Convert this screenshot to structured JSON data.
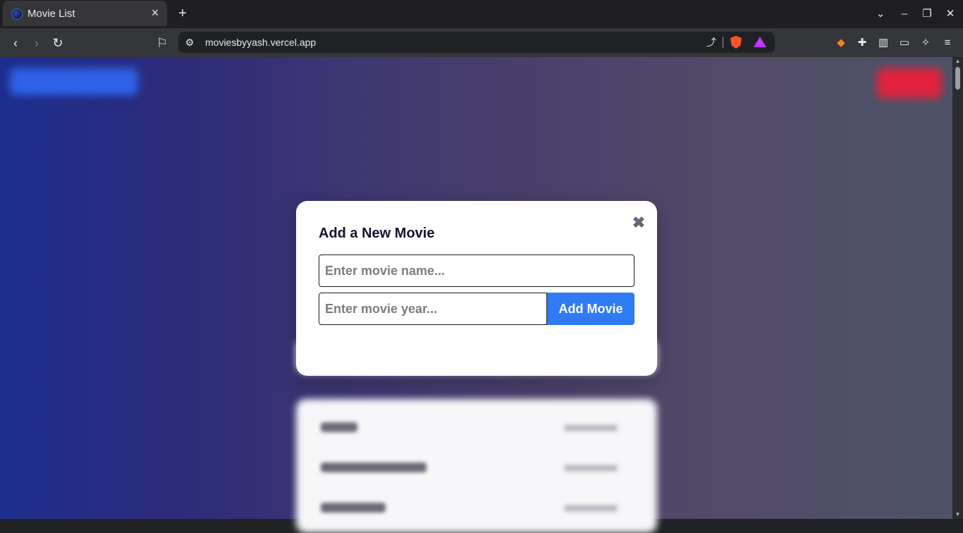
{
  "browser": {
    "tab_title": "Movie List",
    "url": "moviesbyyash.vercel.app"
  },
  "modal": {
    "title": "Add a New Movie",
    "close_symbol": "✖",
    "name_placeholder": "Enter movie name...",
    "year_placeholder": "Enter movie year...",
    "add_label": "Add Movie"
  },
  "colors": {
    "primary_button": "#2f7bf5",
    "logout_button": "#e3213c",
    "login_button": "#2f62e8"
  },
  "icons": {
    "tab": "movie-favicon",
    "toolbar": [
      "back-icon",
      "forward-icon",
      "reload-icon",
      "bookmark-icon",
      "site-info-icon",
      "share-icon",
      "brave-shields-icon",
      "brave-rewards-icon",
      "metamask-icon",
      "extensions-icon",
      "sidebar-icon",
      "wallet-icon",
      "leo-icon",
      "menu-icon"
    ]
  }
}
